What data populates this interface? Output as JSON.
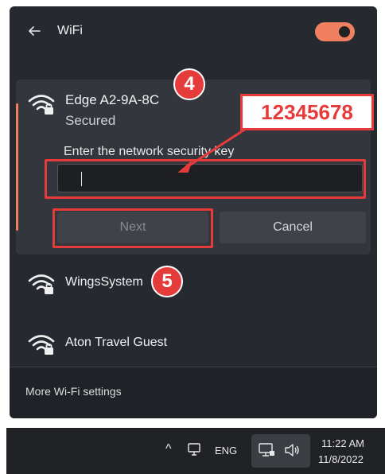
{
  "header": {
    "back_icon": "arrow-left-icon",
    "title": "WiFi",
    "toggle_state": "on",
    "accent_color": "#f08060"
  },
  "expanded_network": {
    "name": "Edge A2-9A-8C",
    "status": "Secured",
    "key_label": "Enter the network security key",
    "key_value": "",
    "next_label": "Next",
    "cancel_label": "Cancel"
  },
  "networks": [
    {
      "name": "WingsSystem"
    },
    {
      "name": "Aton Travel Guest"
    }
  ],
  "footer": {
    "more_settings": "More Wi-Fi settings"
  },
  "taskbar": {
    "chevron": "^",
    "language": "ENG",
    "time": "11:22 AM",
    "date": "11/8/2022"
  },
  "annotations": {
    "step_4": "4",
    "step_5": "5",
    "key_callout": "12345678",
    "highlight_color": "#e53b3b"
  }
}
